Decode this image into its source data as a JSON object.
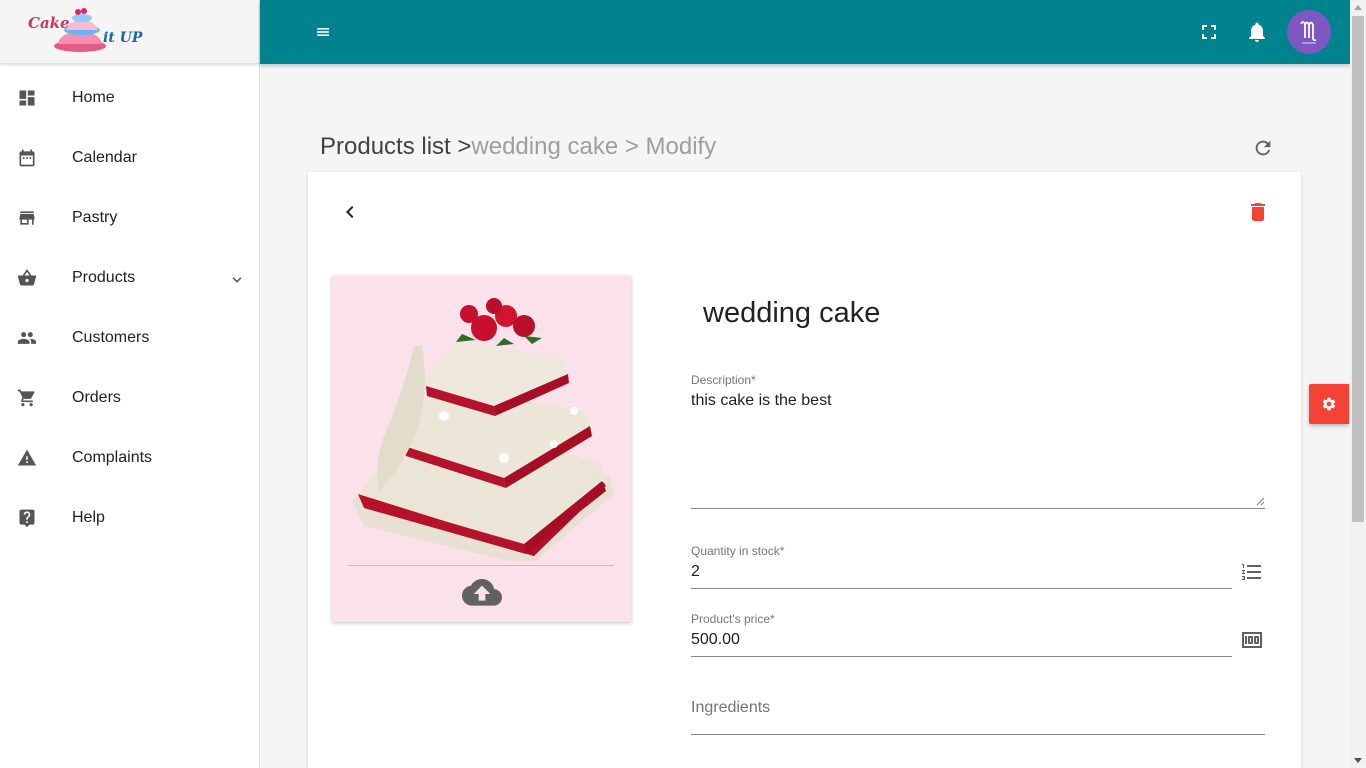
{
  "brand": {
    "logo_word1": "Cake",
    "logo_word2": "it UP"
  },
  "sidebar": {
    "items": [
      {
        "label": "Home",
        "icon": "dashboard-icon"
      },
      {
        "label": "Calendar",
        "icon": "calendar-icon"
      },
      {
        "label": "Pastry",
        "icon": "store-icon"
      },
      {
        "label": "Products",
        "icon": "basket-icon"
      },
      {
        "label": "Customers",
        "icon": "people-icon"
      },
      {
        "label": "Orders",
        "icon": "cart-icon"
      },
      {
        "label": "Complaints",
        "icon": "warning-icon"
      },
      {
        "label": "Help",
        "icon": "help-icon"
      }
    ]
  },
  "breadcrumb": {
    "root": "Products list >",
    "product": "wedding cake",
    "sep": " > ",
    "action": "Modify"
  },
  "product": {
    "name": "wedding cake",
    "description_label": "Description*",
    "description": "this cake is the best",
    "stock_label": "Quantity in stock*",
    "stock": "2",
    "price_label": "Product's price*",
    "price": "500.00",
    "ingredients_placeholder": "Ingredients"
  },
  "colors": {
    "topbar": "#00838f",
    "danger": "#f44336",
    "avatar": "#7e57c2",
    "image_bg": "#fae1ea"
  }
}
